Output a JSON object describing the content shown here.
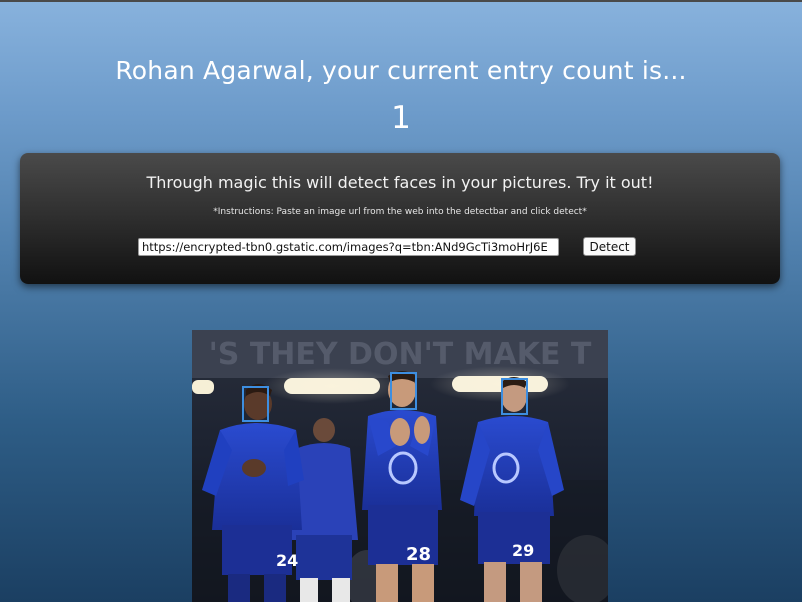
{
  "greeting": "Rohan Agarwal, your current entry count is...",
  "entry_count": "1",
  "detector": {
    "description": "Through magic this will detect faces in your pictures. Try it out!",
    "instructions": "*Instructions: Paste an image url from the web into the detectbar and click detect*",
    "url_value": "https://encrypted-tbn0.gstatic.com/images?q=tbn:ANd9GcTi3moHrJ6E",
    "detect_label": "Detect"
  },
  "photo": {
    "banner_text": "'S THEY DON'T MAKE T",
    "player_numbers": [
      "24",
      "28",
      "29"
    ],
    "face_box_color": "#3d8ee0"
  }
}
